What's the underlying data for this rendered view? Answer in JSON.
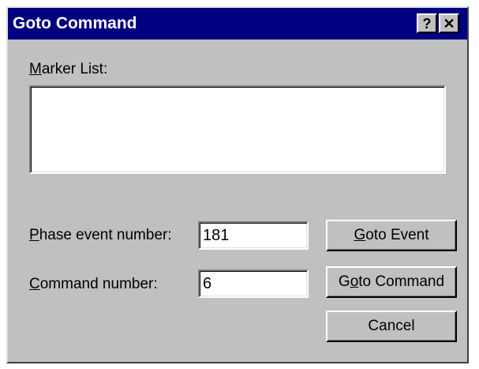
{
  "window": {
    "title": "Goto Command",
    "help_label": "?",
    "close_label": "✕"
  },
  "marker_list": {
    "label_mnemonic": "M",
    "label_rest": "arker List:"
  },
  "phase_event": {
    "label_mnemonic": "P",
    "label_rest": "hase event number:",
    "value": "181"
  },
  "command": {
    "label_mnemonic": "C",
    "label_rest": "ommand number:",
    "value": "6"
  },
  "buttons": {
    "goto_event": {
      "mnemonic": "G",
      "rest": "oto Event"
    },
    "goto_command": {
      "pre": "G",
      "mnemonic": "o",
      "rest": "to Command"
    },
    "cancel": "Cancel"
  },
  "colors": {
    "titlebar": "#000080",
    "dialog_face": "#c0c0c0"
  }
}
